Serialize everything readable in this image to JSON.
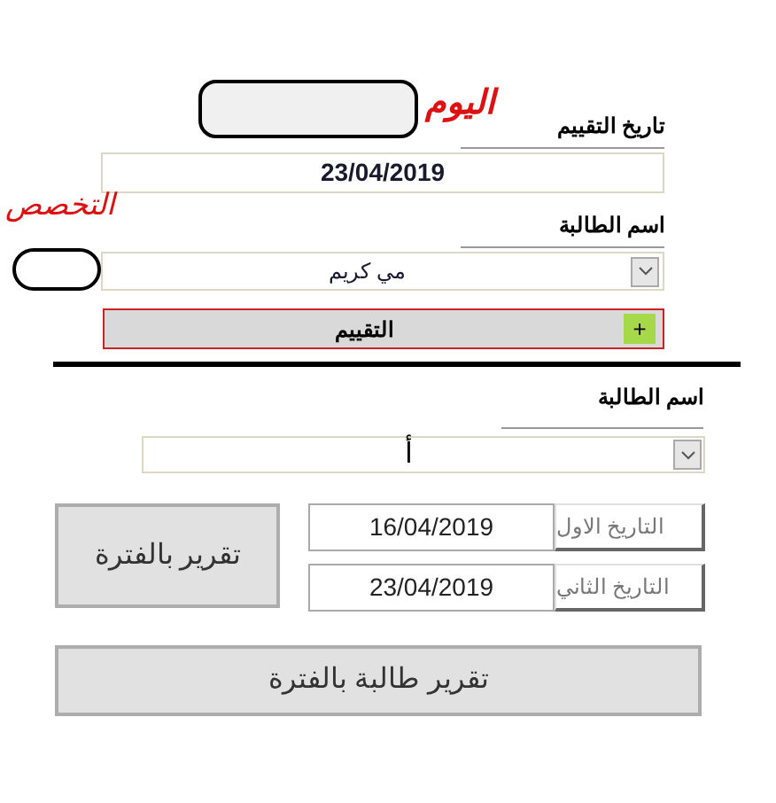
{
  "evaluation_date": {
    "label": "تاريخ التقييم",
    "value": "23/04/2019",
    "annotation": "اليوم"
  },
  "student": {
    "label": "اسم الطالبة",
    "value": "مي كريم",
    "annotation": "التخصص"
  },
  "evaluate_button": {
    "label": "التقييم",
    "icon": "+"
  },
  "report": {
    "student_label": "اسم الطالبة",
    "student_value": "أ",
    "period_button": "تقرير بالفترة",
    "first_date": {
      "label": "التاريخ الاول",
      "value": "16/04/2019"
    },
    "second_date": {
      "label": "التاريخ الثاني",
      "value": "23/04/2019"
    },
    "student_period_button": "تقرير طالبة بالفترة"
  }
}
